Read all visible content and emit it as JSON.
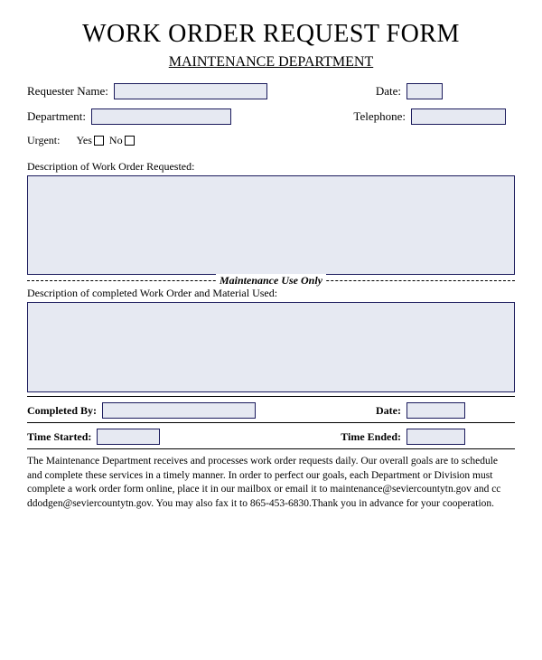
{
  "title": "WORK ORDER REQUEST FORM",
  "subtitle": "MAINTENANCE DEPARTMENT",
  "fields": {
    "requester_name": "Requester Name:",
    "date": "Date:",
    "department": "Department:",
    "telephone": "Telephone:",
    "urgent": "Urgent:",
    "yes": "Yes",
    "no": "No"
  },
  "description_label": "Description of Work Order Requested:",
  "divider": "Maintenance Use Only",
  "completed_description_label": "Description of completed Work Order and Material Used:",
  "completed_by": "Completed By:",
  "date2": "Date:",
  "time_started": "Time Started:",
  "time_ended": "Time Ended:",
  "footer": " The Maintenance Department receives and processes work order requests daily. Our overall goals are to schedule and complete these services in a timely manner.  In order to perfect our goals, each Department or Division must complete a work order form online, place it in our mailbox or email it to maintenance@seviercountytn.gov and cc ddodgen@seviercountytn.gov. You may also fax it to 865-453-6830.Thank you in advance for your cooperation."
}
